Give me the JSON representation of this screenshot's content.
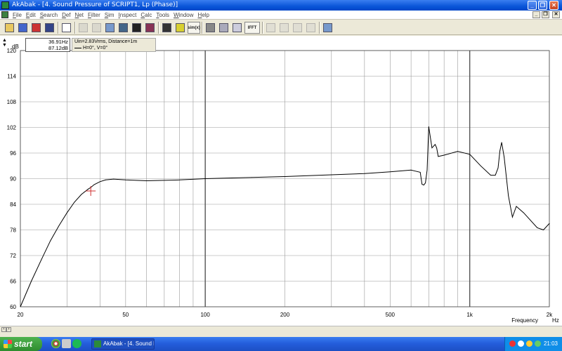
{
  "window": {
    "title": "AkAbak - [4. Sound Pressure of SCRIPT1, Lp (Phase)]",
    "min_label": "_",
    "max_label": "❐",
    "close_label": "✕"
  },
  "menu": {
    "items": [
      "File",
      "Edit",
      "Search",
      "Def",
      "Net",
      "Filter",
      "Sim",
      "Inspect",
      "Calc",
      "Tools",
      "Window",
      "Help"
    ],
    "mdi_min": "_",
    "mdi_restore": "❐",
    "mdi_close": "✕"
  },
  "toolbar": {
    "buttons": [
      {
        "name": "open-icon",
        "label": ""
      },
      {
        "name": "save-icon",
        "label": ""
      },
      {
        "name": "speaker-icon",
        "label": ""
      },
      {
        "name": "circuit-icon",
        "label": ""
      },
      {
        "name": "new-chart-icon",
        "label": ""
      },
      {
        "name": "cursor-icon",
        "label": ""
      },
      {
        "name": "cursor-up-icon",
        "label": ""
      },
      {
        "name": "compare-icon",
        "label": ""
      },
      {
        "name": "filter-icon",
        "label": ""
      },
      {
        "name": "plot-icon",
        "label": ""
      },
      {
        "name": "marker-icon",
        "label": ""
      },
      {
        "name": "battery-icon",
        "label": ""
      },
      {
        "name": "meter-icon",
        "label": ""
      },
      {
        "name": "sim-label",
        "label": "sim(x)"
      },
      {
        "name": "axis-icon",
        "label": ""
      },
      {
        "name": "zoom-icon",
        "label": ""
      },
      {
        "name": "grid-icon",
        "label": ""
      },
      {
        "name": "ifft-label",
        "label": "IFFT"
      },
      {
        "name": "nav-left-icon",
        "label": ""
      },
      {
        "name": "nav-right-icon",
        "label": ""
      },
      {
        "name": "nav-up-icon",
        "label": ""
      },
      {
        "name": "nav-down-icon",
        "label": ""
      },
      {
        "name": "table-icon",
        "label": ""
      }
    ]
  },
  "readout": {
    "freq": "36.91Hz",
    "level": "87.12dB"
  },
  "legend": {
    "line1": "Uin=2.83Vrms, Distance=1m",
    "line2": "H=0°, V=0°"
  },
  "chart_data": {
    "type": "line",
    "title": "",
    "ylabel": "dB",
    "xlabel": "Frequency",
    "xscale": "log",
    "xlim": [
      20,
      2000
    ],
    "ylim": [
      60,
      120
    ],
    "yticks": [
      60,
      66,
      72,
      78,
      84,
      90,
      96,
      102,
      108,
      114,
      120
    ],
    "xtick_labels": [
      {
        "v": 20,
        "t": "20"
      },
      {
        "v": 50,
        "t": "50"
      },
      {
        "v": 100,
        "t": "100"
      },
      {
        "v": 200,
        "t": "200"
      },
      {
        "v": 500,
        "t": "500"
      },
      {
        "v": 1000,
        "t": "1k"
      },
      {
        "v": 2000,
        "t": "2k"
      }
    ],
    "x_unit": "Hz",
    "minor_grid_x": [
      30,
      40,
      60,
      70,
      80,
      90,
      300,
      400,
      600,
      700,
      800,
      900
    ],
    "major_grid_x": [
      100,
      1000
    ],
    "cursor": {
      "x": 36.91,
      "y": 87.12
    },
    "series": [
      {
        "color": "#000000",
        "x": [
          20,
          22,
          24,
          26,
          28,
          30,
          32,
          34,
          36,
          37,
          38,
          40,
          42,
          45,
          50,
          60,
          80,
          100,
          150,
          200,
          300,
          400,
          500,
          600,
          630,
          650,
          660,
          670,
          680,
          690,
          700,
          720,
          740,
          750,
          760,
          800,
          900,
          1000,
          1100,
          1200,
          1250,
          1280,
          1300,
          1320,
          1350,
          1400,
          1450,
          1500,
          1600,
          1800,
          1900,
          2000
        ],
        "y": [
          60,
          66,
          71,
          75.5,
          79,
          82,
          84.5,
          86.3,
          87.5,
          88,
          88.6,
          89.3,
          89.7,
          89.9,
          89.7,
          89.5,
          89.7,
          90,
          90.3,
          90.5,
          90.9,
          91.2,
          91.6,
          92,
          91.7,
          91.5,
          88.7,
          88.5,
          89,
          92,
          102.2,
          97.2,
          98,
          97.2,
          95.2,
          95.5,
          96.4,
          95.7,
          93,
          90.8,
          90.8,
          92.5,
          96.5,
          98.5,
          95,
          86,
          81,
          83.5,
          82,
          78.5,
          78,
          79.5
        ]
      }
    ]
  }
}
